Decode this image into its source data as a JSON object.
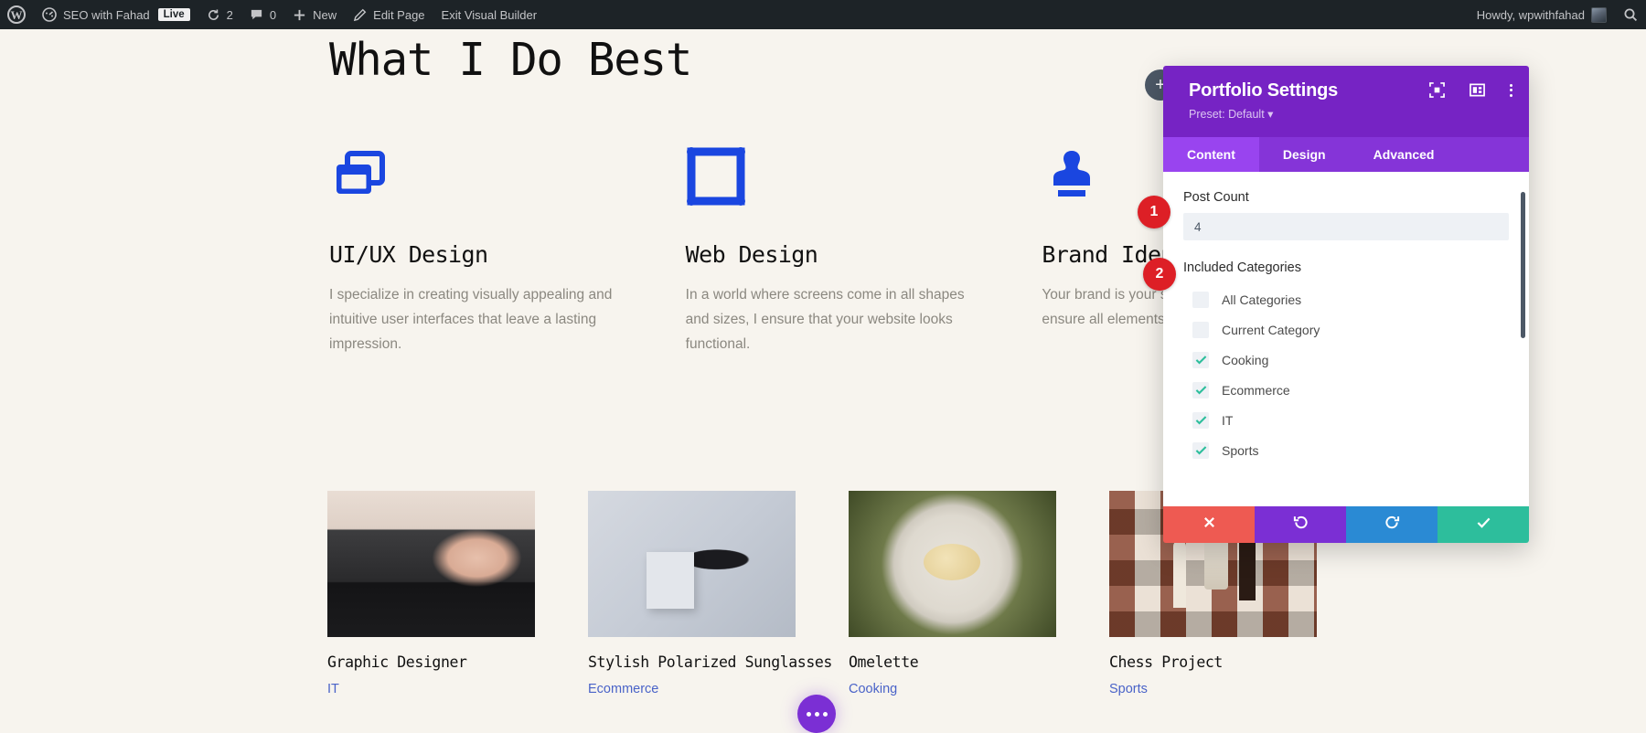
{
  "admin_bar": {
    "wp_logo": "wordpress-logo",
    "site_name": "SEO with Fahad",
    "live_badge": "Live",
    "updates_count": "2",
    "comments_count": "0",
    "new_label": "New",
    "edit_page_label": "Edit Page",
    "exit_builder_label": "Exit Visual Builder",
    "howdy": "Howdy, wpwithfahad",
    "search_icon": "search-icon"
  },
  "page": {
    "title": "What I Do Best",
    "services": [
      {
        "icon": "layers-icon",
        "title": "UI/UX Design",
        "desc": "I specialize in creating visually appealing and intuitive user interfaces that leave a lasting impression."
      },
      {
        "icon": "artboard-frame-icon",
        "title": "Web Design",
        "desc": "In a world where screens come in all shapes and sizes, I ensure that your website looks functional."
      },
      {
        "icon": "stamp-icon",
        "title": "Brand Identity",
        "desc": "Your brand is your story, and you tell it visually. I ensure all elements are aligned."
      }
    ],
    "portfolio": [
      {
        "thumb": "laptop-hands-photo",
        "title": "Graphic Designer",
        "category": "IT"
      },
      {
        "thumb": "sunglasses-photo",
        "title": "Stylish Polarized Sunglasses",
        "category": "Ecommerce"
      },
      {
        "thumb": "omelette-plate-photo",
        "title": "Omelette",
        "category": "Cooking"
      },
      {
        "thumb": "chessboard-photo",
        "title": "Chess Project",
        "category": "Sports"
      }
    ],
    "fab": "more-options-button",
    "add_button": "+"
  },
  "panel": {
    "title": "Portfolio Settings",
    "preset": "Preset: Default",
    "header_icons": [
      "focus-target-icon",
      "layout-columns-icon",
      "kebab-menu-icon"
    ],
    "tabs": [
      {
        "label": "Content",
        "active": true
      },
      {
        "label": "Design",
        "active": false
      },
      {
        "label": "Advanced",
        "active": false
      }
    ],
    "fields": {
      "post_count_label": "Post Count",
      "post_count_value": "4",
      "included_categories_label": "Included Categories"
    },
    "categories": [
      {
        "label": "All Categories",
        "checked": false
      },
      {
        "label": "Current Category",
        "checked": false
      },
      {
        "label": "Cooking",
        "checked": true
      },
      {
        "label": "Ecommerce",
        "checked": true
      },
      {
        "label": "IT",
        "checked": true
      },
      {
        "label": "Sports",
        "checked": true
      }
    ],
    "actions": [
      {
        "name": "close-button",
        "icon": "x-icon"
      },
      {
        "name": "undo-button",
        "icon": "undo-arrow-icon"
      },
      {
        "name": "redo-button",
        "icon": "redo-arrow-icon"
      },
      {
        "name": "save-button",
        "icon": "check-icon"
      }
    ]
  },
  "markers": [
    {
      "number": "1"
    },
    {
      "number": "2"
    }
  ],
  "colors": {
    "panel_purple": "#7623c4",
    "tab_active": "#9944ef",
    "accent_blue": "#1a46e0",
    "marker_red": "#dd1f26",
    "check_teal": "#2dbe9c"
  }
}
